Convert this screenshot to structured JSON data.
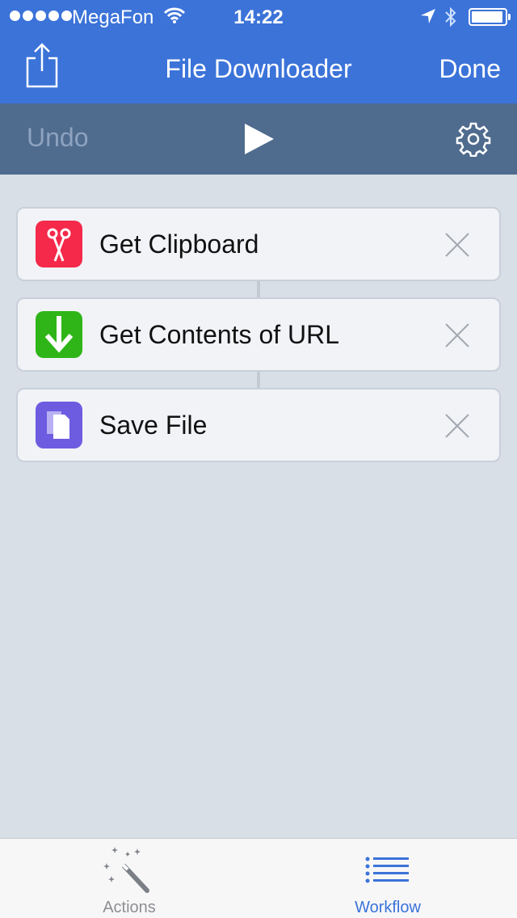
{
  "status_bar": {
    "carrier": "MegaFon",
    "time": "14:22"
  },
  "nav": {
    "title": "File Downloader",
    "done_label": "Done"
  },
  "toolbar": {
    "undo_label": "Undo"
  },
  "actions": [
    {
      "label": "Get Clipboard",
      "icon": "scissors-icon",
      "color": "#f5294a"
    },
    {
      "label": "Get Contents of URL",
      "icon": "download-arrow-icon",
      "color": "#2fb518"
    },
    {
      "label": "Save File",
      "icon": "file-icon",
      "color": "#6e5ce0"
    }
  ],
  "tabs": [
    {
      "label": "Actions",
      "icon": "magic-wand-icon",
      "selected": false
    },
    {
      "label": "Workflow",
      "icon": "list-icon",
      "selected": true
    }
  ],
  "colors": {
    "nav_blue": "#3b73d9",
    "toolbar": "#4f6b8e",
    "background": "#d9dfe7"
  }
}
